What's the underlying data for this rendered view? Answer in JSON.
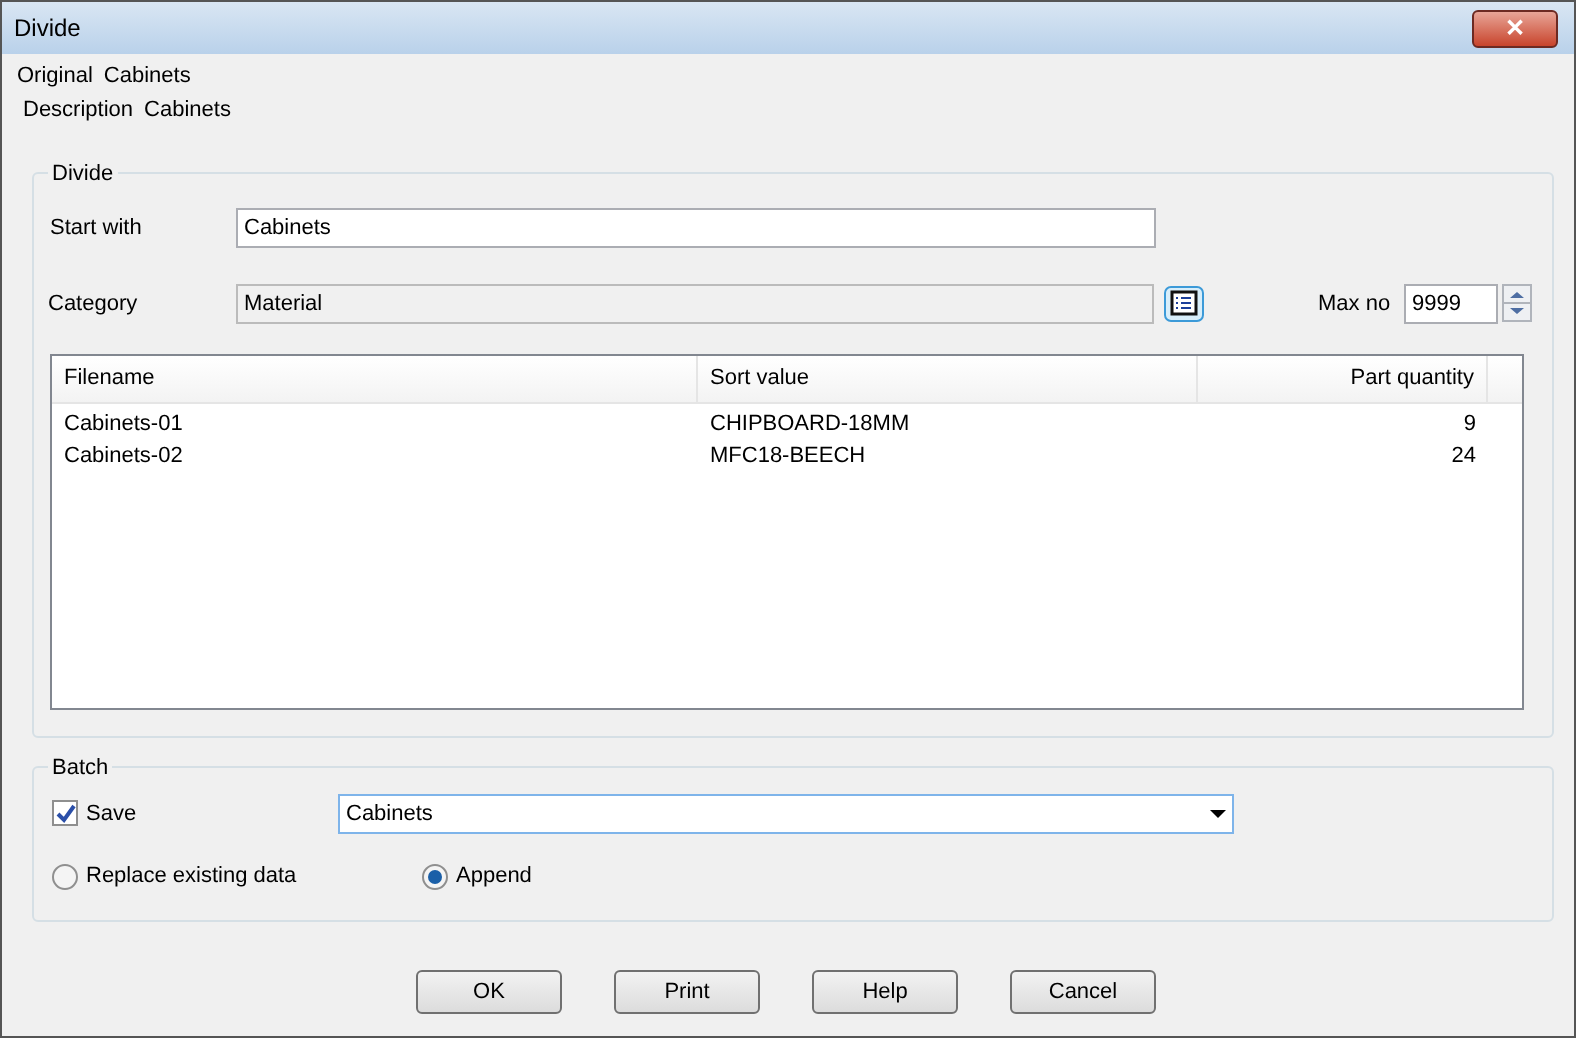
{
  "window": {
    "title": "Divide",
    "close": "✕"
  },
  "info": [
    {
      "label": "Original",
      "value": "Cabinets"
    },
    {
      "label": "Description",
      "value": "Cabinets"
    }
  ],
  "divide": {
    "title": "Divide",
    "start_with": {
      "label": "Start with",
      "value": "Cabinets"
    },
    "category": {
      "label": "Category",
      "value": "Material"
    },
    "max_no": {
      "label": "Max no",
      "value": "9999"
    },
    "table": {
      "columns": [
        "Filename",
        "Sort value",
        "Part quantity"
      ],
      "rows": [
        [
          "Cabinets-01",
          "CHIPBOARD-18MM",
          "9"
        ],
        [
          "Cabinets-02",
          "MFC18-BEECH",
          "24"
        ]
      ]
    }
  },
  "batch": {
    "title": "Batch",
    "save": {
      "label": "Save",
      "checked": true,
      "value": "Cabinets"
    },
    "options": [
      {
        "label": "Replace existing data",
        "selected": false
      },
      {
        "label": "Append",
        "selected": true
      }
    ]
  },
  "buttons": [
    "OK",
    "Print",
    "Help",
    "Cancel"
  ]
}
